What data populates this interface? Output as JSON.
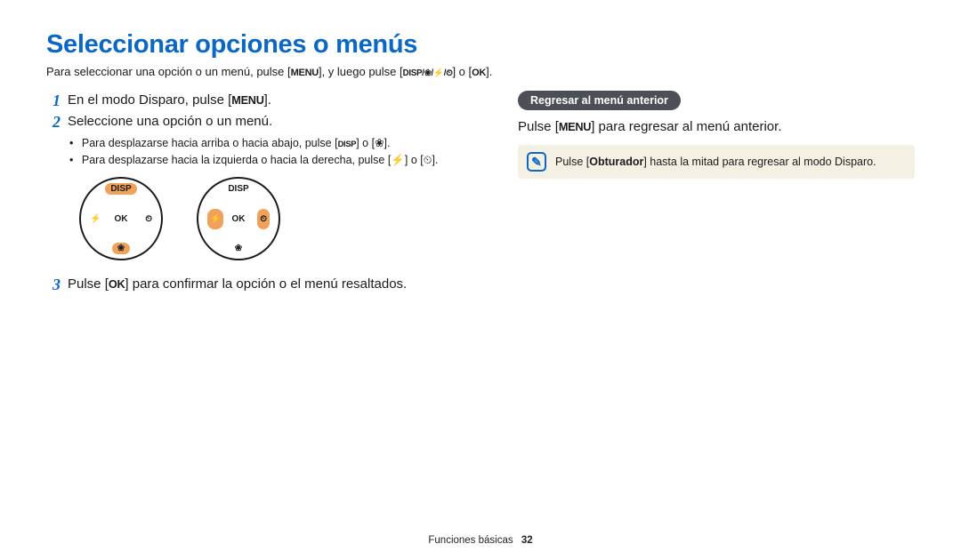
{
  "title": "Seleccionar opciones o menús",
  "intro": {
    "pre": "Para seleccionar una opción o un menú, pulse [",
    "menu": "MENU",
    "mid": "], y luego pulse [",
    "seq": "DISP/❀/⚡/⏲",
    "post1": "] o [",
    "ok": "OK",
    "post2": "]."
  },
  "steps": {
    "s1": {
      "num": "1",
      "pre": "En el modo Disparo, pulse [",
      "menu": "MENU",
      "post": "]."
    },
    "s2": {
      "num": "2",
      "text": "Seleccione una opción o un menú."
    },
    "s2_sub": {
      "a": {
        "pre": "Para desplazarse hacia arriba o hacia abajo, pulse [",
        "a1": "DISP",
        "mid": "] o [",
        "a2": "❀",
        "post": "]."
      },
      "b": {
        "pre": "Para desplazarse hacia la izquierda o hacia la derecha, pulse [",
        "b1": "⚡",
        "mid": "] o [",
        "b2": "⏲",
        "post": "]."
      }
    },
    "s3": {
      "num": "3",
      "pre": "Pulse [",
      "ok": "OK",
      "post": "] para confirmar la opción o el menú resaltados."
    }
  },
  "dial": {
    "top": "DISP",
    "bottom": "❀",
    "left": "⚡",
    "right": "⏲",
    "center": "OK"
  },
  "right": {
    "badge": "Regresar al menú anterior",
    "body_pre": "Pulse [",
    "body_menu": "MENU",
    "body_post": "] para regresar al menú anterior.",
    "note_pre": "Pulse [",
    "note_bold": "Obturador",
    "note_post": "] hasta la mitad para regresar al modo Disparo.",
    "note_icon": "✎"
  },
  "footer": {
    "section": "Funciones básicas",
    "page": "32"
  }
}
